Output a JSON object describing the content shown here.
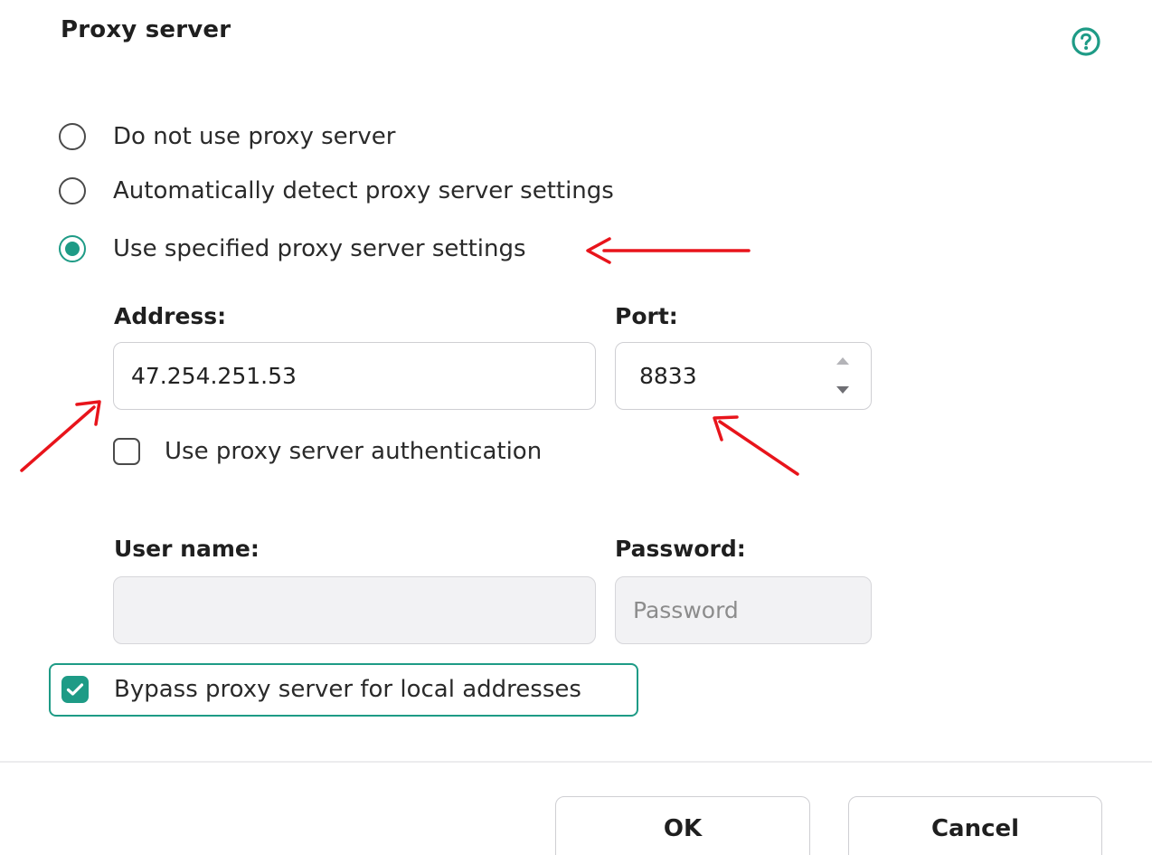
{
  "dialog": {
    "title": "Proxy server",
    "help_icon": "question-circle-icon"
  },
  "proxy_mode": {
    "options": [
      {
        "label": "Do not use proxy server",
        "selected": false
      },
      {
        "label": "Automatically detect proxy server settings",
        "selected": false
      },
      {
        "label": "Use specified proxy server settings",
        "selected": true
      }
    ]
  },
  "address": {
    "label": "Address:",
    "value": "47.254.251.53"
  },
  "port": {
    "label": "Port:",
    "value": "8833"
  },
  "authentication": {
    "label": "Use proxy server authentication",
    "checked": false
  },
  "username": {
    "label": "User name:",
    "value": ""
  },
  "password": {
    "label": "Password:",
    "placeholder": "Password"
  },
  "bypass_local": {
    "label": "Bypass proxy server for local addresses",
    "checked": true
  },
  "buttons": {
    "ok": "OK",
    "cancel": "Cancel"
  },
  "colors": {
    "accent": "#1e9b86",
    "annotation_arrow": "#e8141b"
  }
}
